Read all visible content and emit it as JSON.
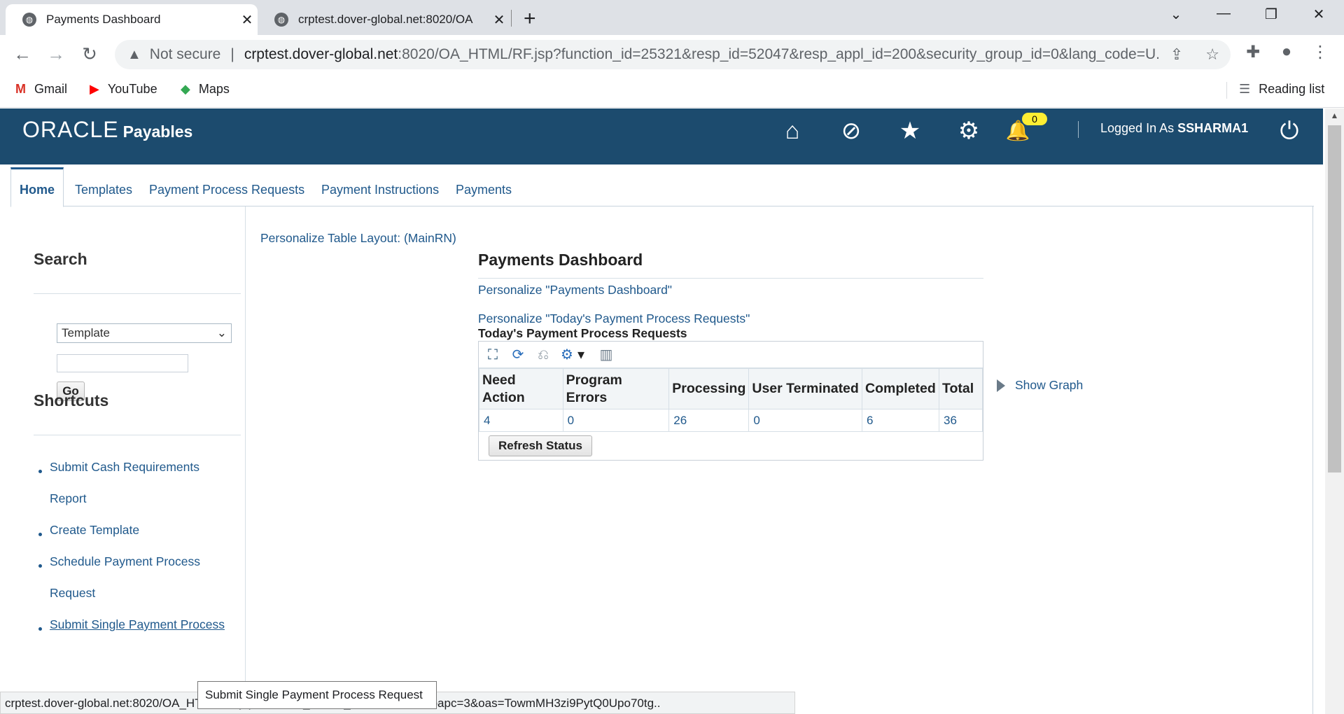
{
  "browser": {
    "tabs": [
      {
        "title": "Payments Dashboard",
        "close": "✕"
      },
      {
        "title": "crptest.dover-global.net:8020/OA",
        "close": "✕"
      }
    ],
    "new_tab": "+",
    "window_controls": {
      "chevron": "⌄",
      "minimize": "—",
      "restore": "❐",
      "close": "✕"
    },
    "nav": {
      "back": "←",
      "forward": "→",
      "reload": "↻"
    },
    "omnibox": {
      "warning_icon": "▲",
      "not_secure": "Not secure",
      "separator": "|",
      "url_host": "crptest.dover-global.net",
      "url_rest": ":8020/OA_HTML/RF.jsp?function_id=25321&resp_id=52047&resp_appl_id=200&security_group_id=0&lang_code=U...",
      "share_icon": "⇪",
      "star_icon": "☆"
    },
    "toolbar_icons": {
      "extensions": "✚",
      "profile": "●",
      "menu": "⋮"
    },
    "bookmarks": [
      {
        "icon": "M",
        "label": "Gmail",
        "color": "#d93025"
      },
      {
        "icon": "▶",
        "label": "YouTube",
        "color": "#ff0000"
      },
      {
        "icon": "◆",
        "label": "Maps",
        "color": "#34a853"
      }
    ],
    "reading_list": {
      "icon": "☰",
      "label": "Reading list"
    }
  },
  "header": {
    "logo": "ORACLE",
    "app_name": "Payables",
    "icons": {
      "home": "⌂",
      "recent": "⊘",
      "favorites": "★",
      "settings": "⚙",
      "notifications": "🔔",
      "logout": "⏻"
    },
    "notification_count": "0",
    "logged_in_prefix": "Logged In As",
    "username": "SSHARMA1"
  },
  "tabs": {
    "home": "Home",
    "templates": "Templates",
    "payment_process_requests": "Payment Process Requests",
    "payment_instructions": "Payment Instructions",
    "payments": "Payments"
  },
  "sidebar": {
    "search_heading": "Search",
    "select_value": "Template",
    "select_arrow": "⌄",
    "go_button": "Go",
    "shortcuts_heading": "Shortcuts",
    "shortcuts": [
      {
        "line1": "Submit Cash Requirements",
        "line2": "Report"
      },
      {
        "line1": "Create Template",
        "line2": ""
      },
      {
        "line1": "Schedule Payment Process",
        "line2": "Request"
      },
      {
        "line1": "Submit Single Payment Process",
        "line2": ""
      }
    ]
  },
  "main": {
    "personalize_table_layout": "Personalize Table Layout: (MainRN)",
    "dashboard_title": "Payments Dashboard",
    "personalize_dashboard": "Personalize \"Payments Dashboard\"",
    "personalize_requests": "Personalize \"Today's Payment Process Requests\"",
    "requests_title": "Today's Payment Process Requests",
    "table_icons": {
      "detach": "⛶",
      "refresh": "⟳",
      "freeze": "⎌",
      "settings": "⚙",
      "dropdown": "▾",
      "columns": "▥"
    },
    "columns": {
      "need_action_1": "Need",
      "need_action_2": "Action",
      "program_errors_1": "Program",
      "program_errors_2": "Errors",
      "processing": "Processing",
      "user_terminated": "User Terminated",
      "completed": "Completed",
      "total": "Total"
    },
    "row": {
      "need_action": "4",
      "program_errors": "0",
      "processing": "26",
      "user_terminated": "0",
      "completed": "6",
      "total": "36"
    },
    "refresh_status": "Refresh Status",
    "show_graph": "Show Graph"
  },
  "status_bar": "crptest.dover-global.net:8020/OA_HTML/RF.jsp?function_id=...&_ti=991980022&oapc=3&oas=TowmMH3zi9PytQ0Upo70tg..",
  "tooltip": "Submit Single Payment Process Request"
}
